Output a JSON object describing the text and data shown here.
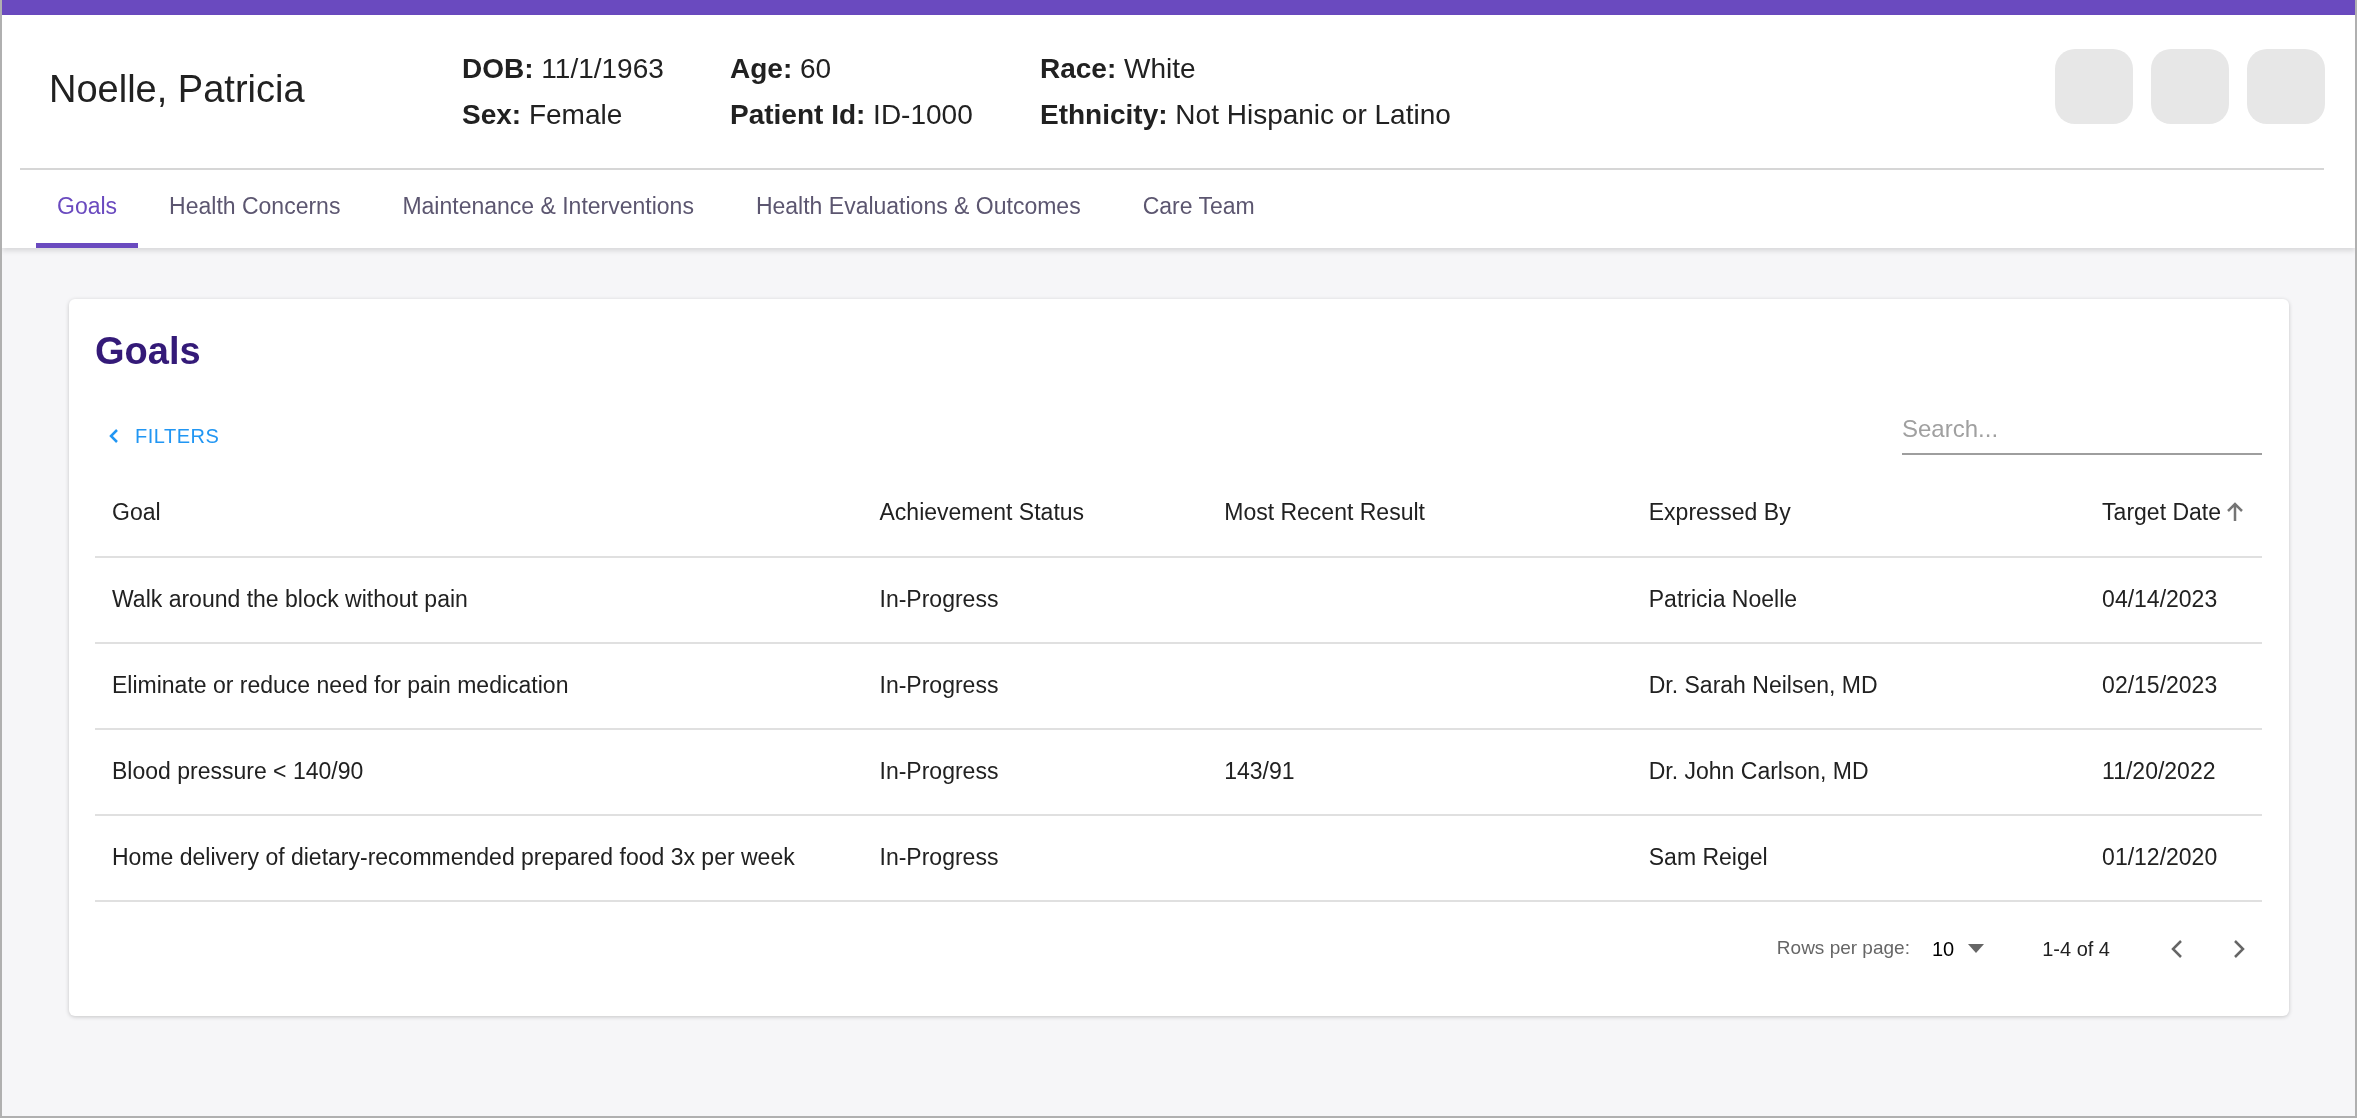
{
  "patient": {
    "name": "Noelle, Patricia",
    "details": [
      [
        {
          "label": "DOB:",
          "value": "11/1/1963"
        },
        {
          "label": "Sex:",
          "value": "Female"
        }
      ],
      [
        {
          "label": "Age:",
          "value": "60"
        },
        {
          "label": "Patient Id:",
          "value": "ID-1000"
        }
      ],
      [
        {
          "label": "Race:",
          "value": "White"
        },
        {
          "label": "Ethnicity:",
          "value": "Not Hispanic or Latino"
        }
      ]
    ]
  },
  "header_buttons": [
    {
      "kind": "blank"
    },
    {
      "kind": "blank"
    },
    {
      "kind": "blank"
    }
  ],
  "tabs": [
    {
      "label": "Goals",
      "selected": true
    },
    {
      "label": "Health Concerns",
      "selected": false
    },
    {
      "label": "Maintenance & Interventions",
      "selected": false
    },
    {
      "label": "Health Evaluations & Outcomes",
      "selected": false
    },
    {
      "label": "Care Team",
      "selected": false
    }
  ],
  "goals_panel": {
    "title": "Goals",
    "filters_button": "FILTERS",
    "search": {
      "placeholder": "Search..."
    },
    "table": {
      "columns": [
        {
          "label": "Goal"
        },
        {
          "label": "Achievement Status"
        },
        {
          "label": "Most Recent Result"
        },
        {
          "label": "Expressed By"
        },
        {
          "label": "Target Date",
          "sorted": true
        }
      ],
      "rows": [
        [
          "Walk around the block without pain",
          "In-Progress",
          "",
          "Patricia Noelle",
          "04/14/2023"
        ],
        [
          "Eliminate or reduce need for pain medication",
          "In-Progress",
          "",
          "Dr. Sarah Neilsen, MD",
          "02/15/2023"
        ],
        [
          "Blood pressure < 140/90",
          "In-Progress",
          "143/91",
          "Dr. John Carlson, MD",
          "11/20/2022"
        ],
        [
          "Home delivery of dietary-recommended prepared food 3x per week",
          "In-Progress",
          "",
          "Sam Reigel",
          "01/12/2020"
        ]
      ]
    },
    "pagination": {
      "rows_per_page_label": "Rows per page:",
      "rows_per_page": "10",
      "range": "1-4 of 4"
    }
  }
}
